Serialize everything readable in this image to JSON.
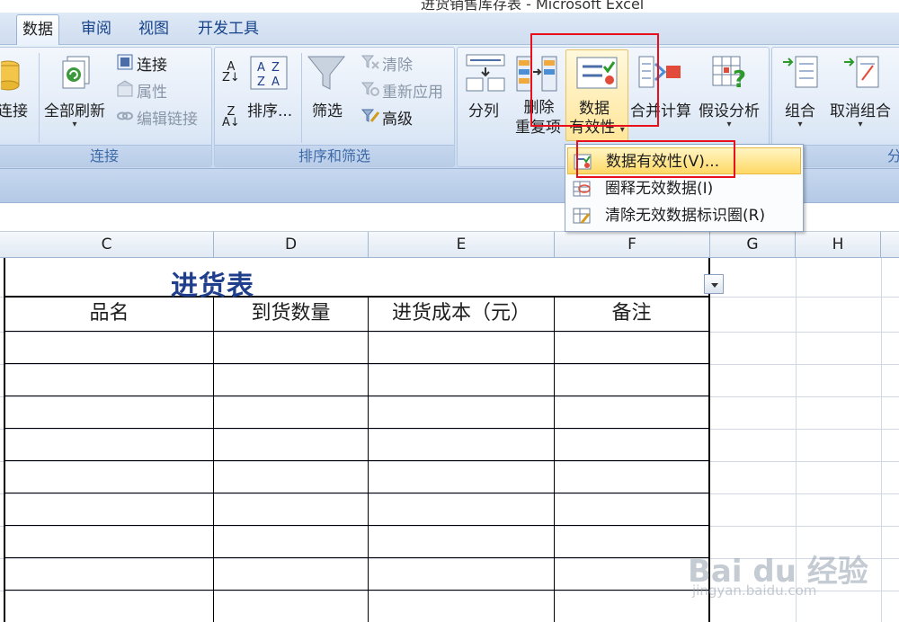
{
  "window": {
    "title": "进货销售库存表 - Microsoft Excel"
  },
  "tabs": [
    {
      "label": "数据",
      "active": true
    },
    {
      "label": "审阅",
      "active": false
    },
    {
      "label": "视图",
      "active": false
    },
    {
      "label": "开发工具",
      "active": false
    }
  ],
  "ribbon": {
    "connections_group": {
      "label": "连接",
      "connect_partial": "连接",
      "refresh_all": "全部刷新",
      "connections": "连接",
      "properties": "属性",
      "edit_links": "编辑链接"
    },
    "sort_filter_group": {
      "label": "排序和筛选",
      "sort": "排序...",
      "filter": "筛选",
      "clear": "清除",
      "reapply": "重新应用",
      "advanced": "高级"
    },
    "data_tools_group": {
      "text_to_columns": "分列",
      "remove_dup_line1": "删除",
      "remove_dup_line2": "重复项",
      "validation_line1": "数据",
      "validation_line2": "有效性",
      "consolidate": "合并计算",
      "what_if": "假设分析"
    },
    "outline_group": {
      "label_partial": "分",
      "group": "组合",
      "ungroup": "取消组合"
    }
  },
  "validation_menu": {
    "items": [
      {
        "label": "数据有效性(V)...",
        "highlighted": true
      },
      {
        "label": "圈释无效数据(I)",
        "highlighted": false
      },
      {
        "label": "清除无效数据标识圈(R)",
        "highlighted": false
      }
    ]
  },
  "columns": [
    "C",
    "D",
    "E",
    "F",
    "G",
    "H"
  ],
  "sheet": {
    "title": "进货表",
    "headers": [
      "品名",
      "到货数量",
      "进货成本（元）",
      "备注"
    ]
  },
  "watermark": {
    "brand": "Bai du 经验",
    "url": "jingyan.baidu.com"
  },
  "colors": {
    "accent_red": "#e8101c",
    "title_blue": "#1f3f8c",
    "tab_text": "#15428b"
  }
}
